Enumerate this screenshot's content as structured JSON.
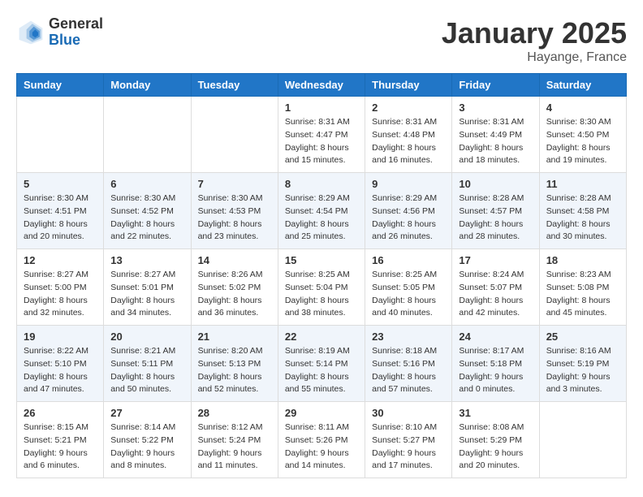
{
  "header": {
    "logo_general": "General",
    "logo_blue": "Blue",
    "month_title": "January 2025",
    "location": "Hayange, France"
  },
  "weekdays": [
    "Sunday",
    "Monday",
    "Tuesday",
    "Wednesday",
    "Thursday",
    "Friday",
    "Saturday"
  ],
  "weeks": [
    [
      {
        "day": "",
        "info": ""
      },
      {
        "day": "",
        "info": ""
      },
      {
        "day": "",
        "info": ""
      },
      {
        "day": "1",
        "info": "Sunrise: 8:31 AM\nSunset: 4:47 PM\nDaylight: 8 hours\nand 15 minutes."
      },
      {
        "day": "2",
        "info": "Sunrise: 8:31 AM\nSunset: 4:48 PM\nDaylight: 8 hours\nand 16 minutes."
      },
      {
        "day": "3",
        "info": "Sunrise: 8:31 AM\nSunset: 4:49 PM\nDaylight: 8 hours\nand 18 minutes."
      },
      {
        "day": "4",
        "info": "Sunrise: 8:30 AM\nSunset: 4:50 PM\nDaylight: 8 hours\nand 19 minutes."
      }
    ],
    [
      {
        "day": "5",
        "info": "Sunrise: 8:30 AM\nSunset: 4:51 PM\nDaylight: 8 hours\nand 20 minutes."
      },
      {
        "day": "6",
        "info": "Sunrise: 8:30 AM\nSunset: 4:52 PM\nDaylight: 8 hours\nand 22 minutes."
      },
      {
        "day": "7",
        "info": "Sunrise: 8:30 AM\nSunset: 4:53 PM\nDaylight: 8 hours\nand 23 minutes."
      },
      {
        "day": "8",
        "info": "Sunrise: 8:29 AM\nSunset: 4:54 PM\nDaylight: 8 hours\nand 25 minutes."
      },
      {
        "day": "9",
        "info": "Sunrise: 8:29 AM\nSunset: 4:56 PM\nDaylight: 8 hours\nand 26 minutes."
      },
      {
        "day": "10",
        "info": "Sunrise: 8:28 AM\nSunset: 4:57 PM\nDaylight: 8 hours\nand 28 minutes."
      },
      {
        "day": "11",
        "info": "Sunrise: 8:28 AM\nSunset: 4:58 PM\nDaylight: 8 hours\nand 30 minutes."
      }
    ],
    [
      {
        "day": "12",
        "info": "Sunrise: 8:27 AM\nSunset: 5:00 PM\nDaylight: 8 hours\nand 32 minutes."
      },
      {
        "day": "13",
        "info": "Sunrise: 8:27 AM\nSunset: 5:01 PM\nDaylight: 8 hours\nand 34 minutes."
      },
      {
        "day": "14",
        "info": "Sunrise: 8:26 AM\nSunset: 5:02 PM\nDaylight: 8 hours\nand 36 minutes."
      },
      {
        "day": "15",
        "info": "Sunrise: 8:25 AM\nSunset: 5:04 PM\nDaylight: 8 hours\nand 38 minutes."
      },
      {
        "day": "16",
        "info": "Sunrise: 8:25 AM\nSunset: 5:05 PM\nDaylight: 8 hours\nand 40 minutes."
      },
      {
        "day": "17",
        "info": "Sunrise: 8:24 AM\nSunset: 5:07 PM\nDaylight: 8 hours\nand 42 minutes."
      },
      {
        "day": "18",
        "info": "Sunrise: 8:23 AM\nSunset: 5:08 PM\nDaylight: 8 hours\nand 45 minutes."
      }
    ],
    [
      {
        "day": "19",
        "info": "Sunrise: 8:22 AM\nSunset: 5:10 PM\nDaylight: 8 hours\nand 47 minutes."
      },
      {
        "day": "20",
        "info": "Sunrise: 8:21 AM\nSunset: 5:11 PM\nDaylight: 8 hours\nand 50 minutes."
      },
      {
        "day": "21",
        "info": "Sunrise: 8:20 AM\nSunset: 5:13 PM\nDaylight: 8 hours\nand 52 minutes."
      },
      {
        "day": "22",
        "info": "Sunrise: 8:19 AM\nSunset: 5:14 PM\nDaylight: 8 hours\nand 55 minutes."
      },
      {
        "day": "23",
        "info": "Sunrise: 8:18 AM\nSunset: 5:16 PM\nDaylight: 8 hours\nand 57 minutes."
      },
      {
        "day": "24",
        "info": "Sunrise: 8:17 AM\nSunset: 5:18 PM\nDaylight: 9 hours\nand 0 minutes."
      },
      {
        "day": "25",
        "info": "Sunrise: 8:16 AM\nSunset: 5:19 PM\nDaylight: 9 hours\nand 3 minutes."
      }
    ],
    [
      {
        "day": "26",
        "info": "Sunrise: 8:15 AM\nSunset: 5:21 PM\nDaylight: 9 hours\nand 6 minutes."
      },
      {
        "day": "27",
        "info": "Sunrise: 8:14 AM\nSunset: 5:22 PM\nDaylight: 9 hours\nand 8 minutes."
      },
      {
        "day": "28",
        "info": "Sunrise: 8:12 AM\nSunset: 5:24 PM\nDaylight: 9 hours\nand 11 minutes."
      },
      {
        "day": "29",
        "info": "Sunrise: 8:11 AM\nSunset: 5:26 PM\nDaylight: 9 hours\nand 14 minutes."
      },
      {
        "day": "30",
        "info": "Sunrise: 8:10 AM\nSunset: 5:27 PM\nDaylight: 9 hours\nand 17 minutes."
      },
      {
        "day": "31",
        "info": "Sunrise: 8:08 AM\nSunset: 5:29 PM\nDaylight: 9 hours\nand 20 minutes."
      },
      {
        "day": "",
        "info": ""
      }
    ]
  ]
}
